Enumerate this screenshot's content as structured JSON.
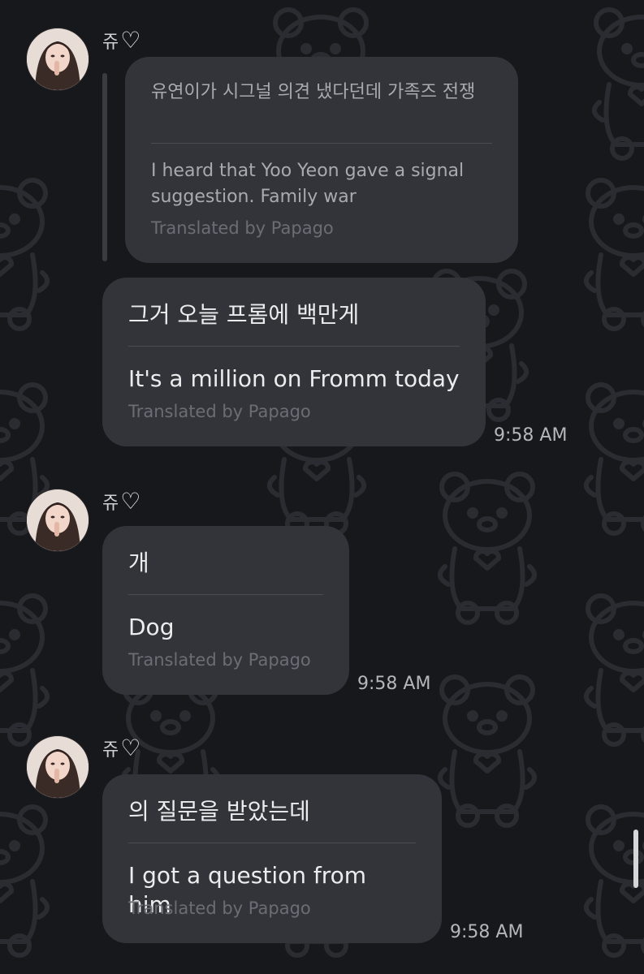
{
  "colors": {
    "background": "#17181c",
    "bubble": "#33343a",
    "credit": "#6c6d74"
  },
  "messages": [
    {
      "sender": "쥬",
      "sender_icon": "white-heart-icon",
      "reply": {
        "original": "유연이가 시그널 의견 냈다던데 가족즈 전쟁",
        "translation": "I heard that Yoo Yeon gave a signal suggestion. Family war",
        "credit": "Translated by Papago"
      },
      "original": "그거 오늘 프롬에 백만게",
      "translation": "It's a million on Fromm today",
      "credit": "Translated by Papago",
      "time": "9:58 AM"
    },
    {
      "sender": "쥬",
      "sender_icon": "white-heart-icon",
      "original": "개",
      "translation": "Dog",
      "credit": "Translated by Papago",
      "time": "9:58 AM"
    },
    {
      "sender": "쥬",
      "sender_icon": "white-heart-icon",
      "original": "의 질문을 받았는데",
      "translation": "I got a question from him",
      "credit": "Translated by Papago",
      "time": "9:58 AM"
    }
  ]
}
